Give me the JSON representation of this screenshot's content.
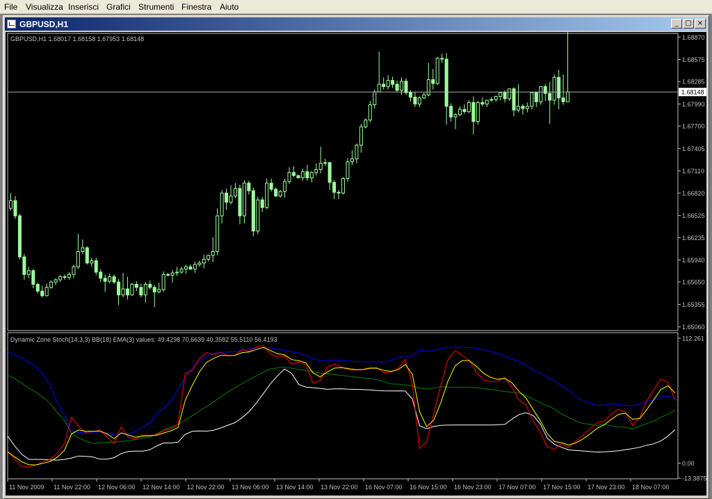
{
  "menu": [
    "File",
    "Visualizza",
    "Inserisci",
    "Grafici",
    "Strumenti",
    "Finestra",
    "Aiuto"
  ],
  "window": {
    "title": "GBPUSD,H1",
    "icons": [
      "chart-window-icon",
      "minimize-icon",
      "maximize-icon",
      "close-icon"
    ]
  },
  "colors": {
    "background": "#000000",
    "candle": "#9cff9c",
    "stoch": "#ff0000",
    "signal": "#ffff00",
    "upper_band": "#0000ff",
    "middle_band": "#008000",
    "lower_band": "#ffffff",
    "grid_axis": "#c0c0c0"
  },
  "chart_data": [
    {
      "type": "candlestick",
      "title": "GBPUSD,H1  1.68017 1.68158 1.67953 1.68148",
      "ylim": [
        1.6503,
        1.689
      ],
      "yticks": [
        "1.68870",
        "1.68575",
        "1.68285",
        "1.67990",
        "1.67700",
        "1.67405",
        "1.67110",
        "1.66820",
        "1.66525",
        "1.66235",
        "1.65940",
        "1.65650",
        "1.65355",
        "1.65060"
      ],
      "current_price": "1.68148",
      "xticks": [
        "11 Nov 2009",
        "11 Nov 22:00",
        "12 Nov 06:00",
        "12 Nov 14:00",
        "12 Nov 22:00",
        "13 Nov 06:00",
        "13 Nov 14:00",
        "13 Nov 22:00",
        "16 Nov 07:00",
        "16 Nov 15:00",
        "16 Nov 23:00",
        "17 Nov 07:00",
        "17 Nov 15:00",
        "17 Nov 23:00",
        "18 Nov 07:00"
      ],
      "close": [
        1.6672,
        1.6652,
        1.6598,
        1.6575,
        1.658,
        1.6562,
        1.6553,
        1.6547,
        1.6558,
        1.6565,
        1.6568,
        1.6572,
        1.6571,
        1.6575,
        1.6585,
        1.6605,
        1.661,
        1.659,
        1.6593,
        1.6578,
        1.657,
        1.6566,
        1.6572,
        1.6565,
        1.6548,
        1.6556,
        1.6548,
        1.6562,
        1.6558,
        1.6548,
        1.6562,
        1.6558,
        1.6552,
        1.6555,
        1.6575,
        1.6574,
        1.6577,
        1.6578,
        1.6582,
        1.6585,
        1.6582,
        1.6588,
        1.659,
        1.6595,
        1.66,
        1.6605,
        1.6652,
        1.6682,
        1.667,
        1.6678,
        1.6688,
        1.6652,
        1.6695,
        1.6685,
        1.6632,
        1.6673,
        1.6663,
        1.6695,
        1.6687,
        1.6678,
        1.6684,
        1.6697,
        1.6709,
        1.6705,
        1.6702,
        1.671,
        1.6702,
        1.6709,
        1.6713,
        1.6721,
        1.6722,
        1.6696,
        1.6683,
        1.6682,
        1.6701,
        1.6723,
        1.6727,
        1.6745,
        1.6769,
        1.6778,
        1.6798,
        1.6815,
        1.6825,
        1.6822,
        1.683,
        1.6825,
        1.6817,
        1.6829,
        1.6814,
        1.6808,
        1.6799,
        1.6807,
        1.6811,
        1.6831,
        1.6826,
        1.6859,
        1.6858,
        1.6796,
        1.6782,
        1.6785,
        1.6792,
        1.6789,
        1.6801,
        1.6776,
        1.6801,
        1.6799,
        1.6804,
        1.6805,
        1.6809,
        1.6814,
        1.6806,
        1.6819,
        1.6791,
        1.6796,
        1.6793,
        1.6796,
        1.6814,
        1.6802,
        1.6822,
        1.6813,
        1.6804,
        1.6834,
        1.6807,
        1.6802,
        1.6815
      ],
      "open": [
        1.6662,
        1.6672,
        1.6652,
        1.6598,
        1.6575,
        1.658,
        1.6562,
        1.6553,
        1.6547,
        1.6558,
        1.6565,
        1.6568,
        1.6572,
        1.6571,
        1.6575,
        1.6585,
        1.6605,
        1.661,
        1.659,
        1.6593,
        1.6578,
        1.657,
        1.6566,
        1.6572,
        1.6565,
        1.6548,
        1.6556,
        1.6548,
        1.6562,
        1.6558,
        1.6548,
        1.6562,
        1.6558,
        1.6552,
        1.6555,
        1.6575,
        1.6574,
        1.6577,
        1.6578,
        1.6582,
        1.6585,
        1.6582,
        1.6588,
        1.659,
        1.6595,
        1.66,
        1.6605,
        1.6652,
        1.6682,
        1.667,
        1.6678,
        1.6688,
        1.6652,
        1.6695,
        1.6685,
        1.6632,
        1.6673,
        1.6663,
        1.6695,
        1.6687,
        1.6678,
        1.6684,
        1.6697,
        1.6709,
        1.6705,
        1.6702,
        1.671,
        1.6702,
        1.6709,
        1.6713,
        1.6721,
        1.6722,
        1.6696,
        1.6683,
        1.6682,
        1.6701,
        1.6723,
        1.6727,
        1.6745,
        1.6769,
        1.6778,
        1.6798,
        1.6815,
        1.6825,
        1.6822,
        1.683,
        1.6825,
        1.6817,
        1.6829,
        1.6814,
        1.6808,
        1.6799,
        1.6807,
        1.6811,
        1.6831,
        1.6826,
        1.6859,
        1.6858,
        1.6796,
        1.6782,
        1.6785,
        1.6792,
        1.6789,
        1.6801,
        1.6776,
        1.6801,
        1.6799,
        1.6804,
        1.6805,
        1.6809,
        1.6814,
        1.6806,
        1.6819,
        1.6791,
        1.6796,
        1.6793,
        1.6796,
        1.6814,
        1.6802,
        1.6822,
        1.6813,
        1.6804,
        1.6834,
        1.6807,
        1.6802
      ],
      "high": [
        1.6682,
        1.6678,
        1.6655,
        1.6602,
        1.6585,
        1.6582,
        1.6564,
        1.656,
        1.6563,
        1.6567,
        1.657,
        1.6574,
        1.6575,
        1.6578,
        1.6588,
        1.6628,
        1.6621,
        1.6612,
        1.6597,
        1.6597,
        1.6582,
        1.6575,
        1.6576,
        1.6575,
        1.6569,
        1.6577,
        1.6572,
        1.6564,
        1.6566,
        1.6563,
        1.6565,
        1.6567,
        1.6561,
        1.6564,
        1.6579,
        1.6577,
        1.6581,
        1.6585,
        1.6585,
        1.6588,
        1.6588,
        1.6592,
        1.6593,
        1.6601,
        1.6601,
        1.6624,
        1.6662,
        1.6686,
        1.6688,
        1.6692,
        1.6695,
        1.6693,
        1.6699,
        1.6698,
        1.6689,
        1.6677,
        1.6677,
        1.6701,
        1.6701,
        1.6689,
        1.6686,
        1.6701,
        1.6716,
        1.6717,
        1.6706,
        1.6714,
        1.6719,
        1.6711,
        1.6721,
        1.6743,
        1.6727,
        1.6723,
        1.6699,
        1.6686,
        1.6703,
        1.6728,
        1.6738,
        1.6747,
        1.6773,
        1.678,
        1.6803,
        1.6818,
        1.6868,
        1.6834,
        1.6837,
        1.6835,
        1.683,
        1.6834,
        1.6833,
        1.6817,
        1.6815,
        1.6809,
        1.6814,
        1.6853,
        1.6845,
        1.6861,
        1.6865,
        1.6866,
        1.68,
        1.6787,
        1.6796,
        1.6799,
        1.6804,
        1.6809,
        1.6803,
        1.6808,
        1.6804,
        1.6808,
        1.681,
        1.6813,
        1.6817,
        1.6816,
        1.6821,
        1.6825,
        1.6799,
        1.6801,
        1.6799,
        1.6815,
        1.6817,
        1.6825,
        1.6828,
        1.6838,
        1.6844,
        1.6838,
        1.6812,
        1.6818
      ],
      "low": [
        1.6659,
        1.6648,
        1.6595,
        1.6568,
        1.657,
        1.6557,
        1.655,
        1.6545,
        1.6546,
        1.6556,
        1.6561,
        1.6565,
        1.6568,
        1.6568,
        1.657,
        1.6582,
        1.6602,
        1.6588,
        1.6585,
        1.6574,
        1.6565,
        1.6552,
        1.6563,
        1.6562,
        1.6535,
        1.6545,
        1.6542,
        1.6547,
        1.6553,
        1.6545,
        1.6538,
        1.6555,
        1.6532,
        1.655,
        1.6552,
        1.6572,
        1.6564,
        1.6573,
        1.6576,
        1.6576,
        1.6581,
        1.6577,
        1.6585,
        1.6583,
        1.6592,
        1.6591,
        1.66,
        1.6642,
        1.666,
        1.6667,
        1.6675,
        1.6641,
        1.6642,
        1.668,
        1.6625,
        1.6628,
        1.6657,
        1.6661,
        1.6684,
        1.6677,
        1.6676,
        1.6676,
        1.6694,
        1.6703,
        1.6701,
        1.6698,
        1.6698,
        1.6696,
        1.6705,
        1.6708,
        1.6718,
        1.6686,
        1.6674,
        1.6674,
        1.668,
        1.6697,
        1.6719,
        1.6721,
        1.6735,
        1.6767,
        1.6775,
        1.6793,
        1.6814,
        1.6818,
        1.6818,
        1.682,
        1.6815,
        1.6811,
        1.6811,
        1.6802,
        1.6795,
        1.6795,
        1.6806,
        1.6809,
        1.6818,
        1.6824,
        1.6853,
        1.6772,
        1.6776,
        1.6766,
        1.6783,
        1.6786,
        1.6787,
        1.6759,
        1.6772,
        1.6796,
        1.6795,
        1.6802,
        1.6802,
        1.6804,
        1.6801,
        1.6803,
        1.6783,
        1.6788,
        1.6785,
        1.6788,
        1.6792,
        1.6795,
        1.6798,
        1.6803,
        1.6773,
        1.6798,
        1.6792,
        1.6798
      ]
    },
    {
      "type": "line",
      "title": "Dynamic Zone Stoch(14,3,3) BB(18) EMA(3) values:  49.4298 70.6639 40.3582 55.5110 56.4193",
      "ylim": [
        -13.3875,
        112.261
      ],
      "yticks": [
        "112.261",
        "0.00",
        "-13.3875"
      ],
      "series": [
        {
          "color": "#ff0000",
          "values": [
            10.6,
            4.0,
            -3.2,
            -3.4,
            -1.6,
            1.2,
            3.3,
            9.3,
            17.7,
            41.3,
            33.3,
            27.3,
            28.7,
            29.3,
            23.7,
            17.6,
            32.7,
            23.2,
            21.3,
            25.4,
            25.0,
            25.6,
            29.3,
            31.1,
            35.1,
            80.6,
            83.1,
            94.0,
            99.4,
            97.7,
            99.5,
            96.6,
            96.8,
            102.1,
            100.5,
            104.2,
            105.9,
            98.4,
            95.3,
            96.3,
            89.0,
            91.0,
            88.4,
            72.1,
            74.1,
            86.0,
            89.1,
            86.4,
            84.0,
            83.5,
            84.0,
            86.2,
            85.6,
            81.3,
            81.7,
            85.4,
            93.4,
            71.0,
            13.3,
            19.1,
            44.6,
            70.2,
            92.8,
            101.2,
            96.9,
            92.3,
            82.0,
            74.7,
            73.4,
            73.6,
            77.0,
            68.6,
            56.8,
            52.4,
            38.1,
            28.2,
            14.7,
            12.5,
            17.4,
            14.1,
            20.0,
            25.1,
            30.8,
            36.3,
            37.8,
            44.0,
            48.4,
            46.1,
            34.0,
            40.7,
            56.0,
            66.2,
            75.6,
            72.7,
            56.4
          ]
        },
        {
          "color": "#ffff00",
          "values": [
            10.3,
            5.6,
            1.3,
            -1.4,
            -1.5,
            -0.1,
            1.6,
            5.5,
            11.6,
            26.4,
            29.9,
            28.6,
            28.6,
            29.0,
            26.3,
            22.0,
            27.3,
            25.3,
            23.3,
            24.4,
            24.7,
            25.1,
            27.2,
            29.2,
            32.1,
            56.4,
            69.8,
            81.9,
            90.6,
            94.2,
            96.8,
            96.7,
            96.8,
            99.4,
            99.9,
            102.1,
            104.0,
            101.2,
            98.3,
            97.3,
            93.1,
            92.1,
            90.2,
            81.2,
            77.6,
            81.8,
            85.4,
            85.9,
            85.0,
            84.2,
            84.1,
            85.2,
            85.4,
            83.3,
            82.5,
            84.0,
            88.7,
            79.8,
            46.6,
            32.8,
            38.7,
            54.5,
            73.6,
            87.4,
            92.2,
            92.2,
            87.1,
            80.9,
            77.1,
            75.4,
            76.2,
            72.4,
            64.6,
            58.5,
            48.3,
            38.3,
            26.5,
            19.5,
            18.4,
            16.3,
            18.2,
            21.6,
            26.2,
            31.3,
            34.5,
            39.3,
            43.8,
            45.0,
            39.5,
            40.1,
            48.0,
            57.1,
            66.4,
            69.5,
            63.0
          ]
        },
        {
          "color": "#0000ff",
          "values": [
            100.2,
            97.0,
            94.8,
            90.6,
            86.2,
            79.7,
            69.7,
            54.2,
            42.9,
            29.1,
            27.4,
            27.8,
            27.8,
            28.1,
            27.0,
            25.1,
            26.5,
            26.0,
            28.6,
            32.6,
            36.0,
            44.1,
            49.8,
            55.7,
            66.4,
            77.0,
            85.3,
            91.8,
            95.7,
            98.5,
            99.7,
            99.9,
            100.2,
            101.5,
            102.8,
            103.6,
            104.1,
            103.6,
            102.8,
            101.1,
            100.3,
            98.9,
            96.7,
            94.2,
            91.8,
            92.4,
            92.5,
            92.5,
            91.7,
            91.4,
            91.0,
            91.1,
            91.1,
            90.9,
            92.4,
            95.1,
            95.5,
            96.6,
            101.4,
            100.6,
            101.2,
            103.2,
            104.2,
            104.3,
            104.2,
            103.8,
            103.4,
            101.8,
            100.6,
            98.6,
            95.9,
            93.6,
            91.6,
            87.9,
            83.4,
            81.2,
            77.1,
            73.8,
            69.8,
            66.0,
            59.7,
            56.2,
            54.1,
            51.7,
            52.1,
            53.4,
            52.8,
            51.9,
            51.4,
            53.3,
            55.3,
            57.0,
            59.7,
            60.2,
            58.0
          ]
        },
        {
          "color": "#008000",
          "values": [
            79.0,
            75.9,
            71.8,
            67.4,
            63.6,
            59.1,
            53.6,
            45.5,
            38.5,
            27.0,
            22.8,
            19.8,
            17.7,
            18.4,
            18.8,
            19.1,
            19.6,
            20.3,
            21.2,
            22.5,
            23.5,
            26.6,
            29.8,
            32.3,
            34.8,
            38.7,
            42.7,
            46.8,
            51.0,
            55.2,
            59.5,
            63.9,
            67.7,
            71.5,
            74.9,
            78.3,
            81.9,
            84.5,
            85.7,
            86.3,
            85.3,
            84.3,
            83.3,
            82.1,
            81.0,
            80.4,
            79.6,
            78.9,
            78.2,
            77.4,
            76.7,
            76.1,
            75.1,
            73.3,
            71.2,
            71.0,
            70.3,
            69.3,
            67.5,
            66.7,
            67.4,
            68.9,
            68.3,
            68.1,
            68.4,
            68.4,
            67.9,
            67.0,
            66.2,
            65.4,
            64.4,
            63.8,
            63.0,
            60.6,
            57.5,
            54.5,
            51.7,
            48.7,
            44.1,
            41.2,
            38.0,
            35.6,
            35.1,
            34.0,
            34.8,
            33.7,
            32.6,
            32.2,
            31.0,
            33.2,
            35.6,
            38.0,
            41.4,
            44.0,
            47.6
          ]
        },
        {
          "color": "#ffffff",
          "values": [
            24.3,
            15.4,
            8.0,
            3.4,
            3.4,
            3.3,
            2.9,
            2.8,
            3.4,
            4.7,
            6.5,
            6.2,
            5.6,
            3.6,
            3.6,
            5.0,
            8.7,
            10.6,
            10.8,
            10.8,
            12.0,
            15.6,
            18.2,
            18.2,
            19.0,
            25.9,
            28.6,
            29.0,
            28.8,
            29.6,
            31.7,
            34.1,
            36.4,
            40.8,
            46.3,
            53.8,
            62.5,
            71.2,
            78.6,
            84.6,
            80.6,
            70.8,
            68.4,
            67.8,
            67.2,
            66.4,
            66.8,
            66.9,
            66.5,
            66.3,
            66.1,
            65.8,
            65.3,
            65.0,
            64.9,
            65.0,
            64.8,
            57.6,
            33.7,
            31.0,
            33.0,
            34.0,
            34.3,
            34.4,
            34.4,
            34.4,
            34.4,
            34.4,
            34.4,
            34.6,
            34.8,
            39.5,
            43.6,
            45.4,
            42.9,
            35.4,
            22.5,
            16.9,
            14.3,
            12.0,
            11.5,
            11.0,
            10.5,
            10.0,
            10.2,
            10.7,
            11.1,
            12.2,
            13.1,
            14.3,
            16.2,
            17.4,
            20.1,
            24.4,
            30.3
          ]
        }
      ]
    }
  ]
}
